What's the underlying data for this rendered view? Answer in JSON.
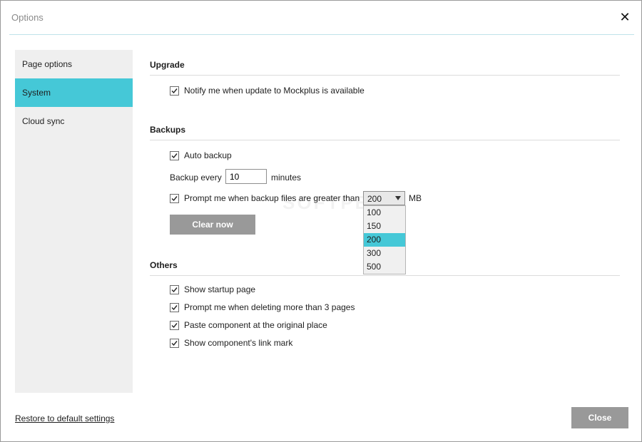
{
  "window": {
    "title": "Options",
    "close_glyph": "✕"
  },
  "sidebar": {
    "items": [
      {
        "label": "Page options"
      },
      {
        "label": "System"
      },
      {
        "label": "Cloud sync"
      }
    ]
  },
  "upgrade": {
    "title": "Upgrade",
    "notify_label": "Notify me when update to Mockplus is available",
    "notify_checked": true
  },
  "backups": {
    "title": "Backups",
    "auto_backup_label": "Auto backup",
    "auto_backup_checked": true,
    "backup_every_label": "Backup every",
    "backup_every_value": "10",
    "minutes_label": "minutes",
    "prompt_label": "Prompt me when backup files are greater than",
    "prompt_checked": true,
    "size_selected": "200",
    "size_options": [
      "100",
      "150",
      "200",
      "300",
      "500"
    ],
    "size_unit": "MB",
    "clear_now_label": "Clear now"
  },
  "others": {
    "title": "Others",
    "items": [
      {
        "label": "Show startup page",
        "checked": true
      },
      {
        "label": "Prompt me when deleting more than 3 pages",
        "checked": true
      },
      {
        "label": "Paste component at the original place",
        "checked": true
      },
      {
        "label": "Show component's link mark",
        "checked": true
      }
    ]
  },
  "footer": {
    "restore_label": "Restore to default settings",
    "close_label": "Close"
  },
  "watermark": "SOFTPEDIA",
  "colors": {
    "accent": "#45c8d7",
    "button_gray": "#999999",
    "sidebar_bg": "#efefef"
  }
}
